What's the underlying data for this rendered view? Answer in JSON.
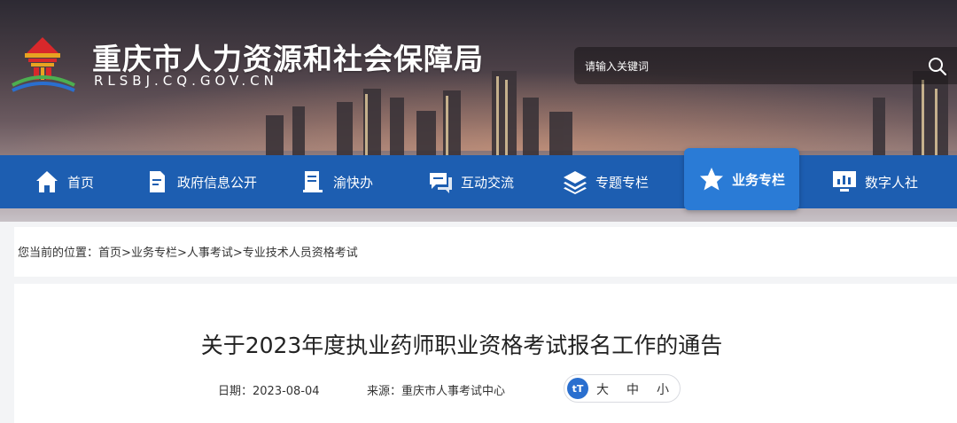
{
  "header": {
    "site_name": "重庆市人力资源和社会保障局",
    "site_domain": "RLSBJ.CQ.GOV.CN",
    "search_placeholder": "请输入关键词"
  },
  "nav": {
    "items": [
      {
        "label": "首页",
        "icon": "home-icon"
      },
      {
        "label": "政府信息公开",
        "icon": "document-icon"
      },
      {
        "label": "渝快办",
        "icon": "book-icon"
      },
      {
        "label": "互动交流",
        "icon": "chat-icon"
      },
      {
        "label": "专题专栏",
        "icon": "layers-icon"
      },
      {
        "label": "业务专栏",
        "icon": "star-icon",
        "active": true
      },
      {
        "label": "数字人社",
        "icon": "monitor-chart-icon"
      }
    ]
  },
  "breadcrumb": {
    "prefix": "您当前的位置：",
    "items": [
      "首页",
      "业务专栏",
      "人事考试",
      "专业技术人员资格考试"
    ],
    "separator": ">"
  },
  "article": {
    "title": "关于2023年度执业药师职业资格考试报名工作的通告",
    "date": "日期：2023-08-04",
    "source": "来源：重庆市人事考试中心",
    "font_size_icon": "tT",
    "font_sizes": [
      "大",
      "中",
      "小"
    ]
  },
  "colors": {
    "nav_bg": "#1d5eb1",
    "nav_active": "#2a7bd6",
    "font_ctrl_icon": "#2a6fcf"
  }
}
